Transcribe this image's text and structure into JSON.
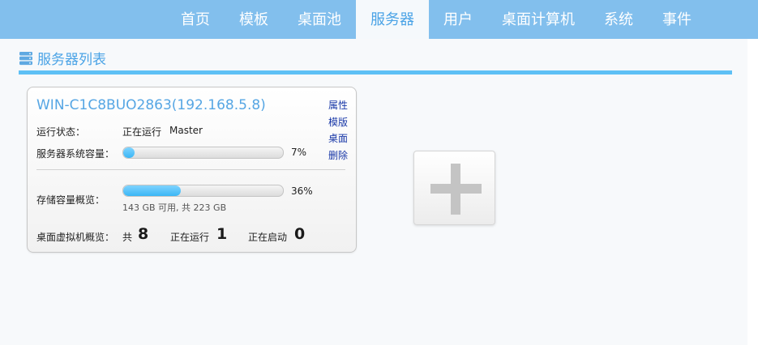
{
  "nav": {
    "items": [
      {
        "label": "首页"
      },
      {
        "label": "模板"
      },
      {
        "label": "桌面池"
      },
      {
        "label": "服务器"
      },
      {
        "label": "用户"
      },
      {
        "label": "桌面计算机"
      },
      {
        "label": "系统"
      },
      {
        "label": "事件"
      }
    ],
    "active": "服务器"
  },
  "page": {
    "title": "服务器列表",
    "title_icon": "server-stack-icon"
  },
  "server_card": {
    "name": "WIN-C1C8BUO2863(192.168.5.8)",
    "actions": [
      "属性",
      "模版",
      "桌面",
      "删除"
    ],
    "status_label": "运行状态：",
    "status_value": "正在运行",
    "role": "Master",
    "sys_capacity_label": "服务器系统容量：",
    "sys_capacity_percent": 7,
    "sys_capacity_text": "7%",
    "storage_label": "存储容量概览：",
    "storage_percent": 36,
    "storage_text": "36%",
    "storage_detail": "143 GB 可用, 共 223 GB",
    "vm_label": "桌面虚拟机概览：",
    "vm_total_label": "共",
    "vm_total": "8",
    "vm_running_label": "正在运行",
    "vm_running": "1",
    "vm_starting_label": "正在启动",
    "vm_starting": "0"
  },
  "add_server": {
    "icon": "plus-icon"
  },
  "colors": {
    "topbar": "#82bfed",
    "accent": "#4aa3e6",
    "rule": "#5ec0f5",
    "progress": "#3ab6f5",
    "link": "#1a39a8"
  }
}
